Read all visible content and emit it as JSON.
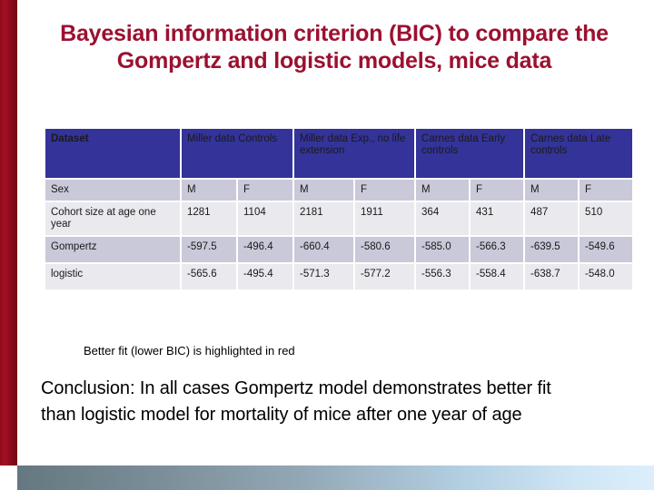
{
  "slide": {
    "title": "Bayesian information criterion (BIC) to compare the Gompertz and logistic models, mice data",
    "caption": "Better fit (lower BIC) is highlighted in red",
    "conclusion": "Conclusion: In all cases Gompertz model demonstrates better fit than logistic model for mortality of mice after one year of age"
  },
  "colors": {
    "title_red": "#9c1030",
    "header_blue": "#333399",
    "accent_stripe": "#a50f24",
    "highlight_red": "#c0283c",
    "row_shaded": "#c9c9d9",
    "row_light": "#e9e9ee"
  },
  "table": {
    "corner_label": "Dataset",
    "groups": [
      {
        "label": "Miller data Controls"
      },
      {
        "label": "Miller data Exp., no life extension"
      },
      {
        "label": "Carnes data Early controls"
      },
      {
        "label": "Carnes data Late controls"
      }
    ],
    "rows": [
      {
        "label": "Sex",
        "style": "shaded",
        "values": [
          "M",
          "F",
          "M",
          "F",
          "M",
          "F",
          "M",
          "F"
        ]
      },
      {
        "label": "Cohort size at age one year",
        "style": "light",
        "values": [
          "1281",
          "1104",
          "2181",
          "1911",
          "364",
          "431",
          "487",
          "510"
        ]
      },
      {
        "label": "Gompertz",
        "style": "shaded",
        "highlight": true,
        "values": [
          "-597.5",
          "-496.4",
          "-660.4",
          "-580.6",
          "-585.0",
          "-566.3",
          "-639.5",
          "-549.6"
        ]
      },
      {
        "label": "logistic",
        "style": "light",
        "highlight": false,
        "values": [
          "-565.6",
          "-495.4",
          "-571.3",
          "-577.2",
          "-556.3",
          "-558.4",
          "-638.7",
          "-548.0"
        ]
      }
    ]
  }
}
